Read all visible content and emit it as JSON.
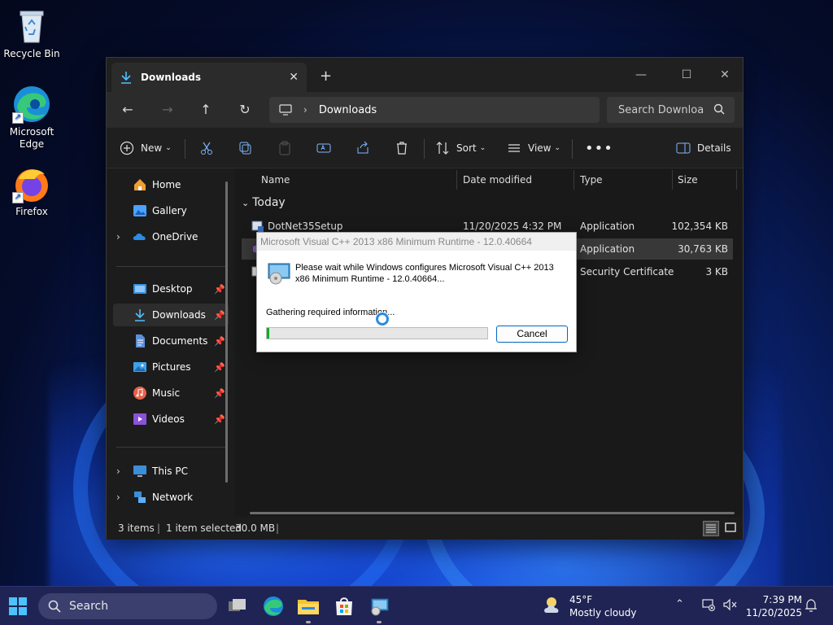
{
  "desktop": {
    "icons": [
      {
        "label": "Recycle Bin"
      },
      {
        "label": "Microsoft Edge"
      },
      {
        "label": "Firefox"
      }
    ]
  },
  "explorer": {
    "tab_title": "Downloads",
    "address_crumb": "Downloads",
    "search_placeholder": "Search Downloa",
    "toolbar": {
      "new_label": "New",
      "sort_label": "Sort",
      "view_label": "View",
      "details_label": "Details"
    },
    "sidebar": {
      "home": "Home",
      "gallery": "Gallery",
      "onedrive": "OneDrive",
      "desktop": "Desktop",
      "downloads": "Downloads",
      "documents": "Documents",
      "pictures": "Pictures",
      "music": "Music",
      "videos": "Videos",
      "thispc": "This PC",
      "network": "Network"
    },
    "columns": {
      "name": "Name",
      "date": "Date modified",
      "type": "Type",
      "size": "Size"
    },
    "group": "Today",
    "files": [
      {
        "name": "DotNet35Setup",
        "date": "11/20/2025 4:32 PM",
        "type": "Application",
        "size": "102,354 KB"
      },
      {
        "name": "",
        "date": "",
        "type": "Application",
        "size": "30,763 KB"
      },
      {
        "name": "",
        "date": "",
        "type": "Security Certificate",
        "size": "3 KB"
      }
    ],
    "status": {
      "items": "3 items",
      "selected": "1 item selected",
      "size": "30.0 MB"
    }
  },
  "dialog": {
    "title": "Microsoft Visual C++ 2013 x86 Minimum Runtime - 12.0.40664",
    "message": "Please wait while Windows configures Microsoft Visual C++ 2013 x86 Minimum Runtime - 12.0.40664...",
    "status": "Gathering required information...",
    "progress": 0.01,
    "cancel_label": "Cancel"
  },
  "taskbar": {
    "search_label": "Search",
    "weather_temp": "45°F",
    "weather_cond": "Mostly cloudy",
    "time": "7:39 PM",
    "date": "11/20/2025"
  }
}
